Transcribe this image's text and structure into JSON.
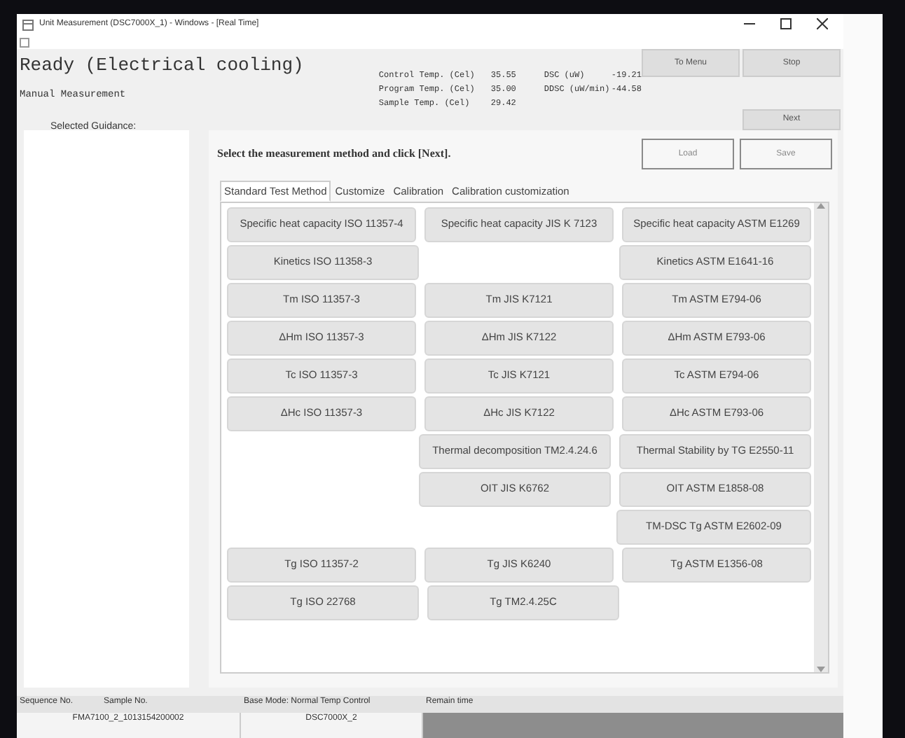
{
  "window": {
    "title": "Unit Measurement (DSC7000X_1) - Windows - [Real Time]"
  },
  "status": "Ready (Electrical cooling)",
  "mode": "Manual Measurement",
  "readings": [
    {
      "label": "Control Temp. (Cel)",
      "value": "35.55",
      "label2": "DSC (uW)",
      "value2": "-19.21"
    },
    {
      "label": "Program Temp. (Cel)",
      "value": "35.00",
      "label2": "DDSC (uW/min)",
      "value2": "-44.58"
    },
    {
      "label": "Sample Temp. (Cel)",
      "value": "29.42"
    }
  ],
  "top_buttons": [
    "To Menu",
    "Stop"
  ],
  "next_button": "Next",
  "guidance_label": "Selected Guidance:",
  "instruction": "Select the measurement method and click [Next].",
  "file_buttons": [
    {
      "label": "Load",
      "disabled": true
    },
    {
      "label": "Save",
      "disabled": true
    }
  ],
  "tabs": [
    {
      "label": "Standard Test Method",
      "selected": true
    },
    {
      "label": "Customize",
      "selected": false
    },
    {
      "label": "Calibration",
      "selected": false
    },
    {
      "label": "Calibration customization",
      "selected": false
    }
  ],
  "methods": [
    {
      "iso": "Specific heat capacity ISO 11357-4",
      "jis": "Specific heat capacity JIS K 7123",
      "astm": "Specific heat capacity ASTM E1269"
    },
    {
      "iso": "Kinetics ISO 11358-3",
      "astm": "Kinetics ASTM E1641-16"
    },
    {
      "iso": "Tm ISO 11357-3",
      "jis": "Tm JIS K7121",
      "astm": "Tm ASTM E794-06"
    },
    {
      "iso": "ΔHm ISO 11357-3",
      "jis": "ΔHm JIS K7122",
      "astm": "ΔHm ASTM E793-06"
    },
    {
      "iso": "Tc ISO 11357-3",
      "jis": "Tc JIS K7121",
      "astm": "Tc ASTM E794-06"
    },
    {
      "iso": "ΔHc ISO 11357-3",
      "jis": "ΔHc JIS K7122",
      "astm": "ΔHc ASTM E793-06"
    },
    {
      "jis": "Thermal decomposition TM2.4.24.6",
      "astm": "Thermal Stability by TG E2550-11"
    },
    {
      "jis": "OIT JIS K6762",
      "astm": "OIT ASTM E1858-08"
    },
    {
      "astm": "TM-DSC Tg ASTM E2602-09"
    },
    {
      "iso": "Tg ISO 11357-2",
      "jis": "Tg JIS K6240",
      "astm": "Tg ASTM E1356-08"
    },
    {
      "iso": "Tg ISO 22768",
      "jis": "Tg TM2.4.25C"
    }
  ],
  "status_bar": {
    "headers": [
      "Sequence No.",
      "Sample No.",
      "Base Mode: Normal Temp Control",
      "Remain time"
    ],
    "values": [
      "FMA7100_2_1013154200002",
      "DSC7000X_2"
    ]
  }
}
